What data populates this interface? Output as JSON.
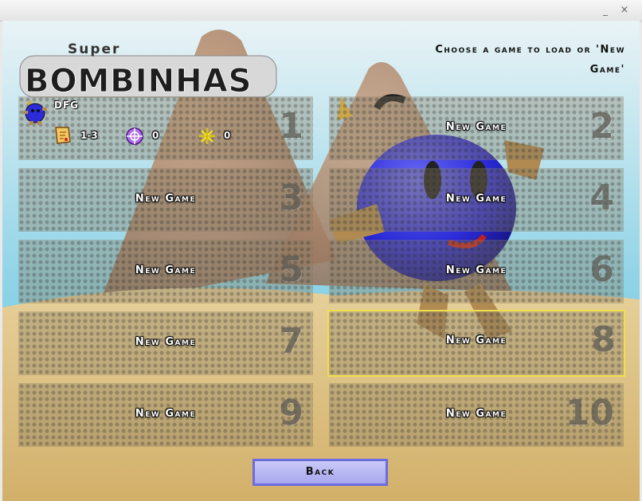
{
  "window": {
    "minimize_glyph": "_",
    "close_glyph": "×"
  },
  "logo": {
    "super": "Super",
    "main": "BOMBINHAS"
  },
  "header": {
    "line1": "Choose a game to load or 'New",
    "line2": "Game'"
  },
  "slots": [
    {
      "number": "1",
      "occupied": true,
      "player": "DFG",
      "level": "1-3",
      "crosshair_count": "0",
      "star_count": "0"
    },
    {
      "number": "2",
      "occupied": false,
      "label": "New Game"
    },
    {
      "number": "3",
      "occupied": false,
      "label": "New Game"
    },
    {
      "number": "4",
      "occupied": false,
      "label": "New Game"
    },
    {
      "number": "5",
      "occupied": false,
      "label": "New Game"
    },
    {
      "number": "6",
      "occupied": false,
      "label": "New Game"
    },
    {
      "number": "7",
      "occupied": false,
      "label": "New Game"
    },
    {
      "number": "8",
      "occupied": false,
      "label": "New Game",
      "selected": true
    },
    {
      "number": "9",
      "occupied": false,
      "label": "New Game"
    },
    {
      "number": "10",
      "occupied": false,
      "label": "New Game"
    }
  ],
  "back_button": {
    "label": "Back"
  },
  "icons": [
    "bomb-avatar-icon",
    "map-scroll-icon",
    "crosshair-icon",
    "star-icon"
  ],
  "colors": {
    "selected_border": "#f0e050",
    "button_fill": "#b8b8f3",
    "button_border": "#6b6ce0",
    "bomb_blue": "#2a2ae0"
  }
}
